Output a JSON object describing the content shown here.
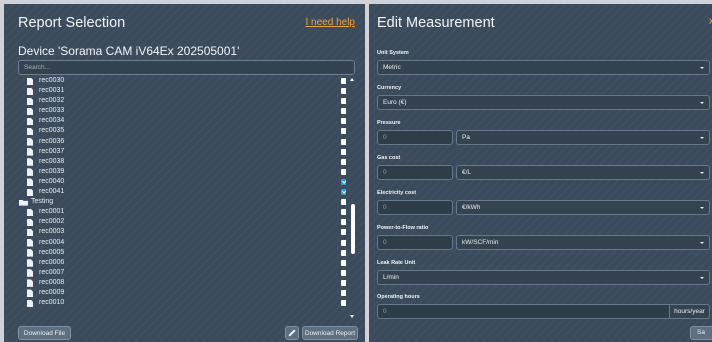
{
  "left_panel": {
    "title": "Report Selection",
    "help_link": "I need help",
    "device_title": "Device 'Sorama CAM iV64Ex 202505001'",
    "search_placeholder": "Search...",
    "tree": [
      {
        "type": "file",
        "label": "rec0030",
        "checked": false
      },
      {
        "type": "file",
        "label": "rec0031",
        "checked": false
      },
      {
        "type": "file",
        "label": "rec0032",
        "checked": false
      },
      {
        "type": "file",
        "label": "rec0033",
        "checked": false
      },
      {
        "type": "file",
        "label": "rec0034",
        "checked": false
      },
      {
        "type": "file",
        "label": "rec0035",
        "checked": false
      },
      {
        "type": "file",
        "label": "rec0036",
        "checked": false
      },
      {
        "type": "file",
        "label": "rec0037",
        "checked": false
      },
      {
        "type": "file",
        "label": "rec0038",
        "checked": false
      },
      {
        "type": "file",
        "label": "rec0039",
        "checked": false
      },
      {
        "type": "file",
        "label": "rec0040",
        "checked": true
      },
      {
        "type": "file",
        "label": "rec0041",
        "checked": true
      },
      {
        "type": "folder",
        "label": "Testing",
        "checked": false
      },
      {
        "type": "file",
        "label": "rec0001",
        "checked": false
      },
      {
        "type": "file",
        "label": "rec0002",
        "checked": false
      },
      {
        "type": "file",
        "label": "rec0003",
        "checked": false
      },
      {
        "type": "file",
        "label": "rec0004",
        "checked": false
      },
      {
        "type": "file",
        "label": "rec0005",
        "checked": false
      },
      {
        "type": "file",
        "label": "rec0006",
        "checked": false
      },
      {
        "type": "file",
        "label": "rec0007",
        "checked": false
      },
      {
        "type": "file",
        "label": "rec0008",
        "checked": false
      },
      {
        "type": "file",
        "label": "rec0009",
        "checked": false
      },
      {
        "type": "file",
        "label": "rec0010",
        "checked": false
      }
    ],
    "download_file_label": "Download File",
    "download_report_label": "Download Report",
    "edit_icon": "pencil-icon"
  },
  "right_panel": {
    "title": "Edit Measurement",
    "close_glyph": "x",
    "unit_system": {
      "label": "Unit System",
      "value": "Metric"
    },
    "currency": {
      "label": "Currency",
      "value": "Euro (€)"
    },
    "pressure": {
      "label": "Pressure",
      "placeholder": "0",
      "unit": "Pa"
    },
    "gas_cost": {
      "label": "Gas cost",
      "placeholder": "0",
      "unit": "€/L"
    },
    "electricity_cost": {
      "label": "Electricity cost",
      "placeholder": "0",
      "unit": "€/kWh"
    },
    "power_to_flow": {
      "label": "Power-to-Flow ratio",
      "placeholder": "0",
      "unit": "kW/SCF/min"
    },
    "leak_rate_unit": {
      "label": "Leak Rate Unit",
      "value": "L/min"
    },
    "operating_hours": {
      "label": "Operating hours",
      "placeholder": "0",
      "suffix": "hours/year"
    },
    "save_label": "Sa"
  },
  "colors": {
    "accent": "#e8a43c",
    "panel": "#3b4b5b",
    "checkbox_checked": "#2a9fd6"
  }
}
